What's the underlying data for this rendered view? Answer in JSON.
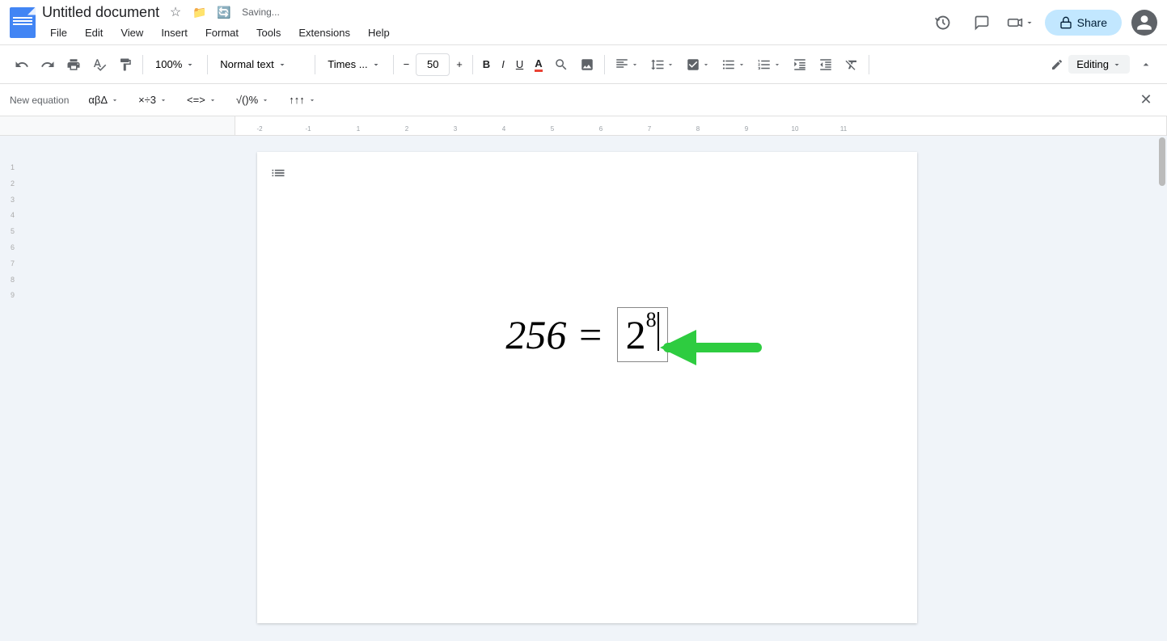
{
  "titleBar": {
    "docTitle": "Untitled document",
    "savingText": "Saving...",
    "starIcon": "★",
    "driveIcon": "🗂",
    "syncIcon": "🔄"
  },
  "menuBar": {
    "items": [
      "File",
      "Edit",
      "View",
      "Insert",
      "Format",
      "Tools",
      "Extensions",
      "Help"
    ]
  },
  "rightControls": {
    "historyIcon": "🕐",
    "chatIcon": "💬",
    "meetIcon": "📹",
    "shareLabel": "Share",
    "lockIcon": "🔒"
  },
  "toolbar": {
    "undoLabel": "↩",
    "redoLabel": "↪",
    "printLabel": "🖨",
    "paintLabel": "🎨",
    "copyFormat": "⊡",
    "zoomLevel": "100%",
    "styleDropdown": "Normal text",
    "fontDropdown": "Times ...",
    "fontSizeMinus": "−",
    "fontSize": "50",
    "fontSizePlus": "+",
    "textColor": "A",
    "highlight": "✏",
    "imageInsert": "⊞",
    "alignIcon": "≡",
    "lineSpacing": "↕",
    "checkList": "☑",
    "bulletList": "☰",
    "numberedList": "①",
    "indent": "→|",
    "outdent": "|←",
    "clearFormat": "✕",
    "editingLabel": "Editing",
    "collapseIcon": "⌃"
  },
  "equationBar": {
    "newEquationLabel": "New equation",
    "greekBtn": "αβΔ▾",
    "opsBtn": "×÷3▾",
    "relationsBtn": "<=>▾",
    "mathBtn": "√()%▾",
    "arrowsBtn": "↑↑↑▾",
    "closeIcon": "✕"
  },
  "document": {
    "equation": "256 = 2⁸",
    "equationLeft": "256 =",
    "equationBase": "2",
    "equationExp": "8"
  },
  "colors": {
    "accent": "#4285f4",
    "shareBtn": "#c2e7ff",
    "arrowGreen": "#2ecc40"
  }
}
